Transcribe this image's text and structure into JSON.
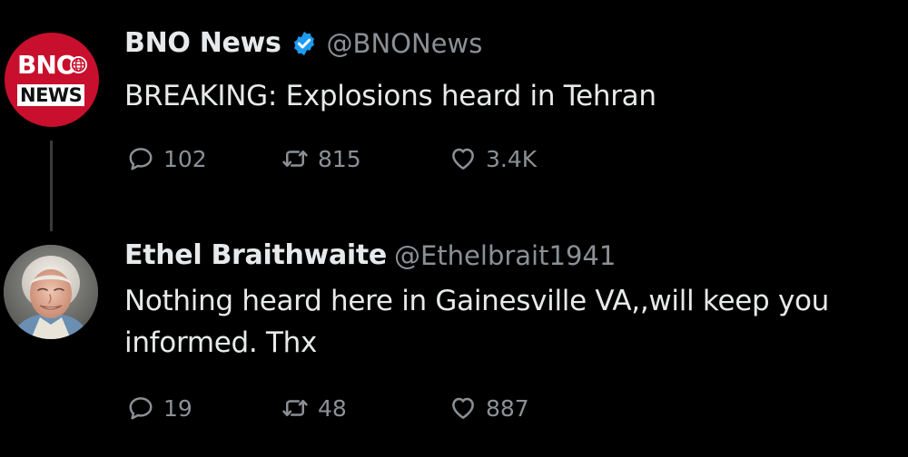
{
  "tweets": [
    {
      "author": {
        "display_name": "BNO News",
        "handle": "@BNONews",
        "verified": true,
        "avatar": {
          "type": "logo",
          "line1": "BNO",
          "line2": "NEWS",
          "icon": "globe-icon",
          "background": "#c8102e"
        }
      },
      "text": "BREAKING: Explosions heard in Tehran",
      "stats": {
        "replies": "102",
        "retweets": "815",
        "likes": "3.4K"
      }
    },
    {
      "author": {
        "display_name": "Ethel Braithwaite",
        "handle": "@Ethelbrait1941",
        "verified": false,
        "avatar": {
          "type": "photo",
          "icon": "elderly-woman-photo"
        }
      },
      "text": "Nothing heard here in Gainesville VA,,will keep you informed. Thx",
      "stats": {
        "replies": "19",
        "retweets": "48",
        "likes": "887"
      }
    }
  ],
  "theme": {
    "background": "#000000",
    "text": "#e7e9ea",
    "muted": "#8b9096",
    "verified_blue": "#1d9bf0",
    "thread_line": "#3a3a3a"
  }
}
